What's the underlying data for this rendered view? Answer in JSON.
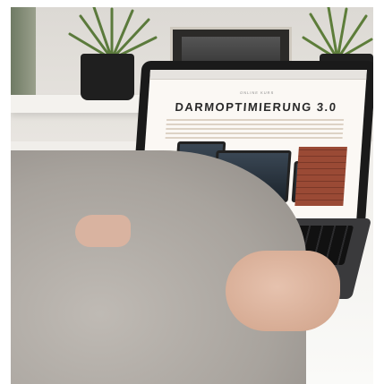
{
  "screen": {
    "subtitle": "ONLINE KURS",
    "headline": "DARMOPTIMIERUNG 3.0"
  },
  "colors": {
    "wall": "#dcd9d4",
    "desk": "#f0eeea",
    "laptop": "#1a1a1a",
    "sleeve": "#a8a39d",
    "skin": "#d9b3a0"
  }
}
